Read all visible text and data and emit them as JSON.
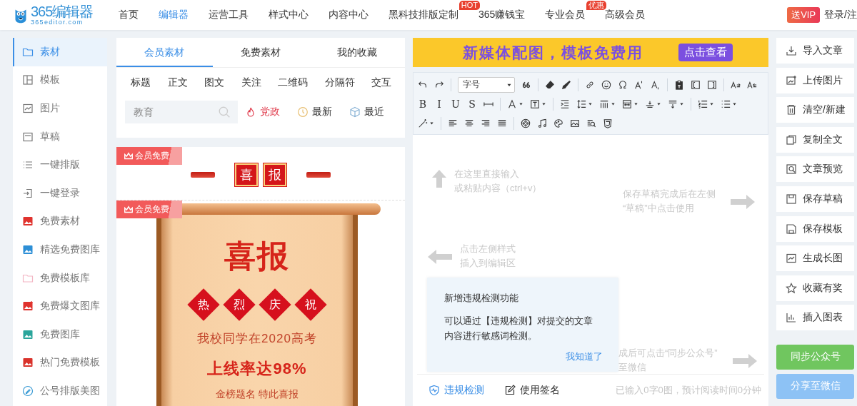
{
  "header": {
    "logo": {
      "title": "365编辑器",
      "subtitle": "365editor.com"
    },
    "nav": [
      {
        "label": "首页",
        "selected": false
      },
      {
        "label": "编辑器",
        "selected": true
      },
      {
        "label": "运营工具",
        "selected": false
      },
      {
        "label": "样式中心",
        "selected": false
      },
      {
        "label": "内容中心",
        "selected": false
      },
      {
        "label": "黑科技排版定制",
        "selected": false,
        "badge": "HOT"
      },
      {
        "label": "365赚钱宝",
        "selected": false
      },
      {
        "label": "专业会员",
        "selected": false,
        "badge": "优惠"
      },
      {
        "label": "高级会员",
        "selected": false
      }
    ],
    "vip_badge": "送VIP",
    "login": "登录/注"
  },
  "sidebar": {
    "items": [
      {
        "label": "素材",
        "selected": true
      },
      {
        "label": "模板",
        "selected": false
      },
      {
        "label": "图片",
        "selected": false
      },
      {
        "label": "草稿",
        "selected": false
      },
      {
        "label": "一键排版",
        "selected": false
      },
      {
        "label": "一键登录",
        "selected": false
      },
      {
        "label": "免费素材",
        "selected": false
      },
      {
        "label": "精选免费图库",
        "selected": false
      },
      {
        "label": "免费模板库",
        "selected": false
      },
      {
        "label": "免费爆文图库",
        "selected": false
      },
      {
        "label": "免费图库",
        "selected": false
      },
      {
        "label": "热门免费模板",
        "selected": false
      },
      {
        "label": "公号排版美图",
        "selected": false
      }
    ]
  },
  "materials": {
    "tabs": [
      {
        "label": "会员素材",
        "selected": true
      },
      {
        "label": "免费素材",
        "selected": false
      },
      {
        "label": "我的收藏",
        "selected": false
      }
    ],
    "categories": [
      "标题",
      "正文",
      "图文",
      "关注",
      "二维码",
      "分隔符",
      "交互"
    ],
    "search": {
      "placeholder": "教育"
    },
    "tags": [
      {
        "label": "党政",
        "kind": "hot"
      },
      {
        "label": "最新",
        "kind": "new"
      },
      {
        "label": "最近",
        "kind": "recent"
      }
    ],
    "cards": [
      {
        "kind": "header",
        "tag": "会员免费",
        "chars": [
          "喜",
          "报"
        ]
      },
      {
        "kind": "scroll",
        "tag": "会员免费",
        "title": "喜报",
        "diamonds": [
          "热",
          "烈",
          "庆",
          "祝"
        ],
        "line1": "我校同学在2020高考",
        "line2": "上线率达98%",
        "line3": "金榜题名 特此喜报"
      }
    ]
  },
  "editor": {
    "banner": {
      "text": "新媒体配图，模板免费用",
      "button": "点击查看"
    },
    "toolbar": [
      [
        [
          {
            "kind": "icon",
            "dropdown": false
          },
          {
            "kind": "icon",
            "dropdown": false
          }
        ],
        [
          {
            "kind": "select",
            "label": "字号"
          },
          {
            "kind": "icon",
            "dropdown": false
          }
        ],
        [
          {
            "kind": "icon",
            "dropdown": false
          },
          {
            "kind": "icon",
            "dropdown": false
          }
        ],
        [
          {
            "kind": "icon",
            "dropdown": false
          },
          {
            "kind": "icon",
            "dropdown": false
          },
          {
            "kind": "icon",
            "dropdown": false
          },
          {
            "kind": "icon",
            "dropdown": false
          },
          {
            "kind": "icon",
            "dropdown": false
          }
        ],
        [
          {
            "kind": "icon",
            "dropdown": false
          },
          {
            "kind": "icon",
            "dropdown": false
          },
          {
            "kind": "icon",
            "dropdown": false
          }
        ],
        [
          {
            "kind": "icon",
            "dropdown": false
          },
          {
            "kind": "icon",
            "dropdown": false
          }
        ]
      ],
      [
        [
          {
            "kind": "letter",
            "label": "B"
          },
          {
            "kind": "letter",
            "label": "I"
          },
          {
            "kind": "letter",
            "label": "U"
          },
          {
            "kind": "letter",
            "label": "S"
          },
          {
            "kind": "icon",
            "dropdown": false
          }
        ],
        [
          {
            "kind": "icon",
            "dropdown": true
          },
          {
            "kind": "icon",
            "dropdown": true
          }
        ],
        [
          {
            "kind": "icon",
            "dropdown": false
          },
          {
            "kind": "icon",
            "dropdown": true
          },
          {
            "kind": "icon",
            "dropdown": true
          },
          {
            "kind": "icon",
            "dropdown": true
          },
          {
            "kind": "icon",
            "dropdown": true
          },
          {
            "kind": "icon",
            "dropdown": true
          }
        ],
        [
          {
            "kind": "icon",
            "dropdown": true
          },
          {
            "kind": "icon",
            "dropdown": true
          }
        ]
      ],
      [
        [
          {
            "kind": "icon",
            "dropdown": true
          }
        ],
        [
          {
            "kind": "icon",
            "dropdown": false
          },
          {
            "kind": "icon",
            "dropdown": false
          },
          {
            "kind": "icon",
            "dropdown": false
          },
          {
            "kind": "icon",
            "dropdown": false
          }
        ],
        [
          {
            "kind": "icon",
            "dropdown": false
          },
          {
            "kind": "icon",
            "dropdown": false
          },
          {
            "kind": "icon",
            "dropdown": false
          },
          {
            "kind": "icon",
            "dropdown": false
          },
          {
            "kind": "icon",
            "dropdown": false
          },
          {
            "kind": "icon",
            "dropdown": false
          }
        ]
      ]
    ],
    "hints": [
      {
        "kind": "up",
        "lines": [
          "在这里直接输入",
          "或粘贴内容（ctrl+v）"
        ]
      },
      {
        "kind": "right",
        "lines": [
          "保存草稿完成后在左侧",
          "“草稿”中点击使用"
        ]
      },
      {
        "kind": "left",
        "lines": [
          "点击左侧样式",
          "插入到编辑区"
        ]
      },
      {
        "kind": "right",
        "lines": [
          "成后可点击“同步公众号”",
          "至微信"
        ]
      }
    ],
    "popup": {
      "title": "新增违规检测功能",
      "body": "可以通过【违规检测】对提交的文章内容进行敏感词检测。",
      "action": "我知道了"
    },
    "footer": {
      "check": "违规检测",
      "signature": "使用签名",
      "status": "已输入0字0图，预计阅读时间0分钟"
    }
  },
  "actions": {
    "buttons": [
      "导入文章",
      "上传图片",
      "清空/新建",
      "复制全文",
      "文章预览",
      "保存草稿",
      "保存模板",
      "生成长图",
      "收藏有奖",
      "插入图表"
    ],
    "sync": "同步公众号",
    "share": "分享至微信"
  }
}
